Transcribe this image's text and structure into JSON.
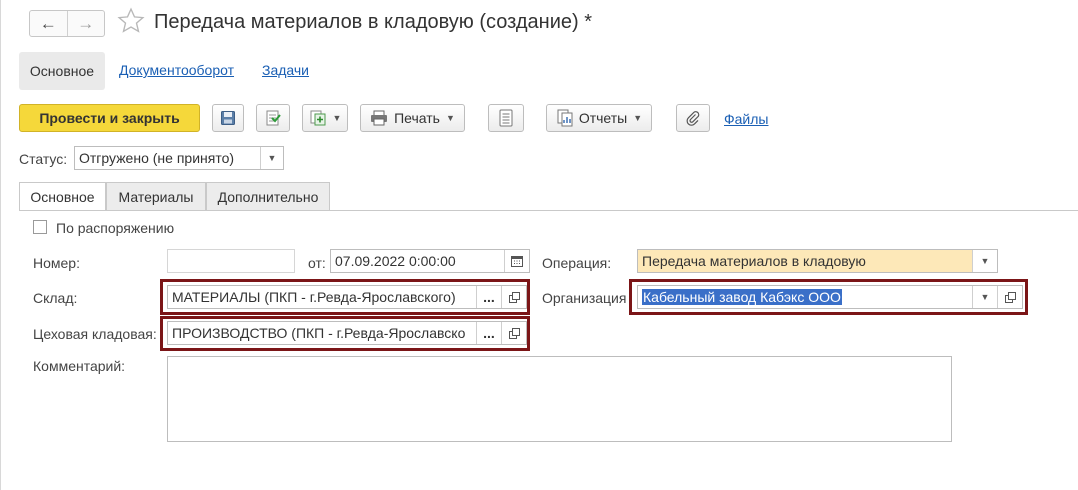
{
  "window": {
    "title": "Передача материалов в кладовую (создание) *"
  },
  "section_nav": {
    "items": [
      {
        "label": "Основное"
      },
      {
        "label": "Документооборот"
      },
      {
        "label": "Задачи"
      }
    ]
  },
  "toolbar": {
    "post_close_label": "Провести и закрыть",
    "print_label": "Печать",
    "reports_label": "Отчеты",
    "files_label": "Файлы"
  },
  "status": {
    "label": "Статус:",
    "value": "Отгружено (не принято)"
  },
  "tabs": [
    {
      "label": "Основное",
      "active": true
    },
    {
      "label": "Материалы",
      "active": false
    },
    {
      "label": "Дополнительно",
      "active": false
    }
  ],
  "form": {
    "by_order_label": "По распоряжению",
    "by_order_checked": false,
    "number_label": "Номер:",
    "number_value": "",
    "date_label": "от:",
    "date_value": "07.09.2022  0:00:00",
    "operation_label": "Операция:",
    "operation_value": "Передача материалов в кладовую",
    "warehouse_label": "Склад:",
    "warehouse_value": "МАТЕРИАЛЫ (ПКП - г.Ревда-Ярославского)",
    "organization_label": "Организация",
    "organization_value": "Кабельный завод Кабэкс ООО",
    "shop_storeroom_label": "Цеховая кладовая:",
    "shop_storeroom_value": "ПРОИЗВОДСТВО (ПКП - г.Ревда-Ярославско",
    "comment_label": "Комментарий:",
    "comment_value": "",
    "ellipsis": "..."
  },
  "colors": {
    "primary_button": "#f5d83a",
    "link": "#1a5fb4",
    "highlight_border": "#7b1517",
    "operation_field": "#fde8b8"
  }
}
